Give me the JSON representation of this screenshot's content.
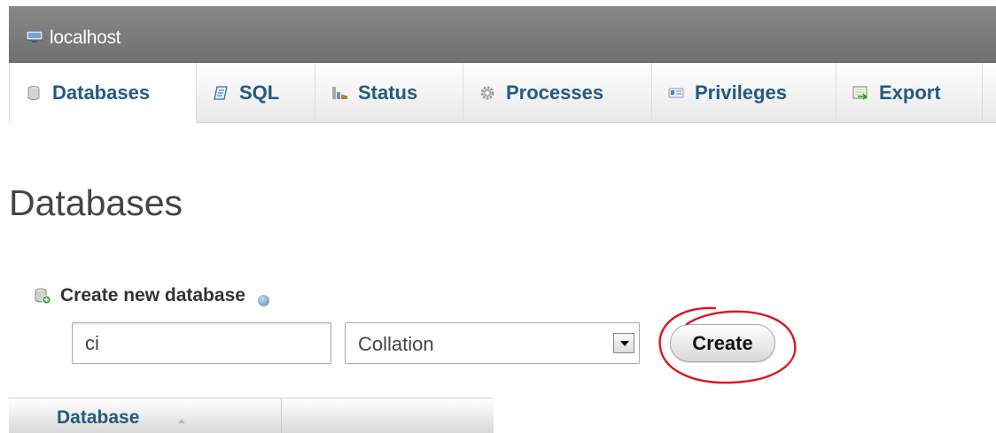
{
  "server_bar": {
    "label": "localhost",
    "icon": "server-icon"
  },
  "tabs": [
    {
      "label": "Databases",
      "icon": "database-icon",
      "active": true
    },
    {
      "label": "SQL",
      "icon": "sql-icon"
    },
    {
      "label": "Status",
      "icon": "status-icon"
    },
    {
      "label": "Processes",
      "icon": "processes-icon"
    },
    {
      "label": "Privileges",
      "icon": "privileges-icon"
    },
    {
      "label": "Export",
      "icon": "export-icon"
    }
  ],
  "page": {
    "title": "Databases"
  },
  "create_db": {
    "heading": "Create new database",
    "name_value": "ci",
    "collation_label": "Collation",
    "create_label": "Create"
  },
  "table": {
    "columns": [
      "Database",
      ""
    ]
  },
  "colors": {
    "link": "#235a81",
    "server_bar": "#7a7a7a",
    "annotation": "#e0141e"
  }
}
